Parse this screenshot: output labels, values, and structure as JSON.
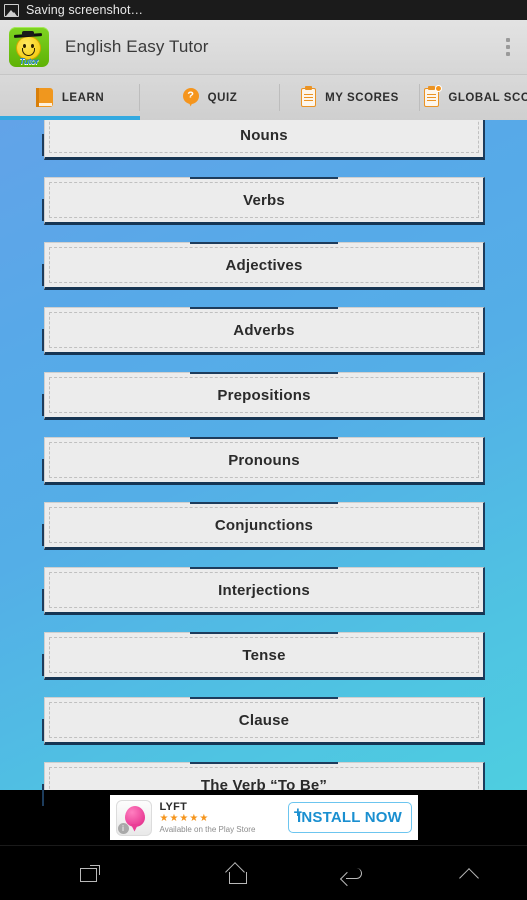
{
  "status_bar": {
    "icon": "screenshot-image-icon",
    "text": "Saving screenshot…"
  },
  "action_bar": {
    "app_icon": "app-logo-graduate-smiley",
    "icon_caption": "Tutor",
    "title": "English Easy Tutor",
    "overflow_menu": "overflow-menu-icon"
  },
  "tabs": [
    {
      "label": "LEARN",
      "icon": "book-icon",
      "active": true
    },
    {
      "label": "QUIZ",
      "icon": "question-pin-icon",
      "active": false
    },
    {
      "label": "MY SCORES",
      "icon": "clipboard-icon",
      "active": false
    },
    {
      "label": "GLOBAL SCORES",
      "icon": "clipboard-badge-icon",
      "active": false
    }
  ],
  "learn_list": [
    {
      "label": "Nouns"
    },
    {
      "label": "Verbs"
    },
    {
      "label": "Adjectives"
    },
    {
      "label": "Adverbs"
    },
    {
      "label": "Prepositions"
    },
    {
      "label": "Pronouns"
    },
    {
      "label": "Conjunctions"
    },
    {
      "label": "Interjections"
    },
    {
      "label": "Tense"
    },
    {
      "label": "Clause"
    },
    {
      "label": "The Verb “To Be”"
    }
  ],
  "ad": {
    "icon": "lyft-balloon-icon",
    "info_badge": "i",
    "title": "LYFT",
    "stars": "★★★★★",
    "subtitle": "Available on the Play Store",
    "cta_label": "INSTALL NOW",
    "cta_plus": "+"
  },
  "nav_bar": [
    {
      "icon": "recent-apps-icon"
    },
    {
      "icon": "home-icon"
    },
    {
      "icon": "back-icon"
    },
    {
      "icon": "chevron-up-icon"
    }
  ],
  "colors": {
    "accent_blue": "#33a9e0",
    "icon_orange": "#f0971e",
    "bg_top": "#62a3e8",
    "bg_bottom": "#4ecfe0",
    "btn_edge": "#1d3c5c",
    "ad_pink": "#ea3d96",
    "ad_cta_blue": "#1a8fd0"
  }
}
